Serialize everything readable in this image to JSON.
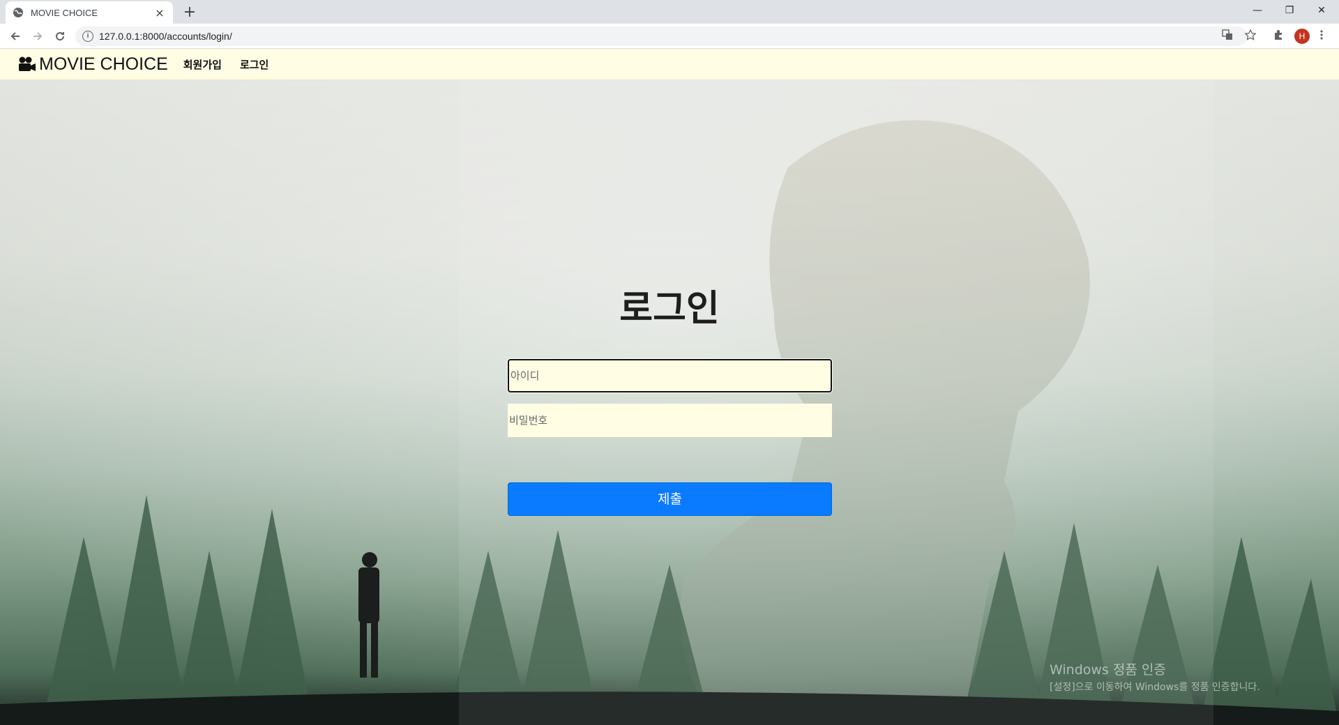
{
  "browser": {
    "tab_title": "MOVIE CHOICE",
    "tab_close": "×",
    "new_tab": "+",
    "url": "127.0.0.1:8000/accounts/login/",
    "avatar_initial": "H",
    "window_controls": {
      "minimize": "—",
      "restore": "❐",
      "close": "✕"
    }
  },
  "navbar": {
    "brand": "MOVIE CHOICE",
    "links": [
      "회원가입",
      "로그인"
    ]
  },
  "login": {
    "title": "로그인",
    "username_placeholder": "아이디",
    "password_placeholder": "비밀번호",
    "submit_label": "제출"
  },
  "watermark": {
    "line1": "Windows 정품 인증",
    "line2": "[설정]으로 이동하여 Windows를 정품 인증합니다."
  },
  "colors": {
    "navbar_bg": "#fffde3",
    "input_bg": "#fffde3",
    "submit_bg": "#0a7bff"
  }
}
